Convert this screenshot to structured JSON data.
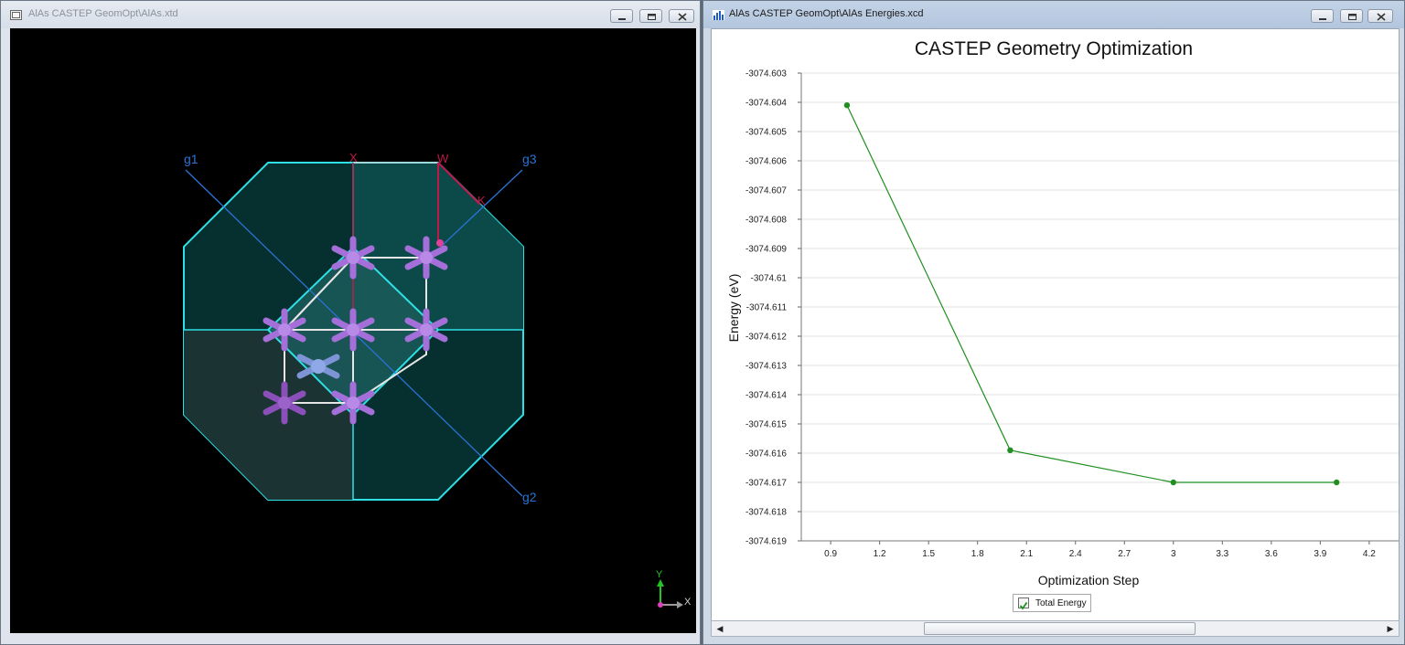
{
  "left_window": {
    "title": "AlAs CASTEP GeomOpt\\AlAs.xtd",
    "axis_labels": {
      "g1": "g1",
      "g2": "g2",
      "g3": "g3",
      "x_top": "X",
      "w": "W",
      "k": "K"
    },
    "triad": {
      "x": "X",
      "y": "Y"
    }
  },
  "right_window": {
    "title": "AlAs CASTEP GeomOpt\\AlAs Energies.xcd"
  },
  "chart_data": {
    "type": "line",
    "title": "CASTEP Geometry Optimization",
    "xlabel": "Optimization Step",
    "ylabel": "Energy (eV)",
    "xlim": [
      0.72,
      4.38
    ],
    "ylim": [
      -3074.619,
      -3074.603
    ],
    "x_ticks": [
      "0.9",
      "1.2",
      "1.5",
      "1.8",
      "2.1",
      "2.4",
      "2.7",
      "3",
      "3.3",
      "3.6",
      "3.9",
      "4.2"
    ],
    "x_tick_values": [
      0.9,
      1.2,
      1.5,
      1.8,
      2.1,
      2.4,
      2.7,
      3.0,
      3.3,
      3.6,
      3.9,
      4.2
    ],
    "y_ticks": [
      "-3074.603",
      "-3074.604",
      "-3074.605",
      "-3074.606",
      "-3074.607",
      "-3074.608",
      "-3074.609",
      "-3074.61",
      "-3074.611",
      "-3074.612",
      "-3074.613",
      "-3074.614",
      "-3074.615",
      "-3074.616",
      "-3074.617",
      "-3074.618",
      "-3074.619"
    ],
    "y_tick_values": [
      -3074.603,
      -3074.604,
      -3074.605,
      -3074.606,
      -3074.607,
      -3074.608,
      -3074.609,
      -3074.61,
      -3074.611,
      -3074.612,
      -3074.613,
      -3074.614,
      -3074.615,
      -3074.616,
      -3074.617,
      -3074.618,
      -3074.619
    ],
    "grid": "horizontal",
    "legend_position": "bottom-center",
    "series": [
      {
        "name": "Total Energy",
        "color": "#1f8f1f",
        "x": [
          1,
          2,
          3,
          4
        ],
        "y": [
          -3074.6041,
          -3074.6159,
          -3074.617,
          -3074.617
        ]
      }
    ]
  },
  "colors": {
    "series": "#1f8f1f",
    "cyan": "#2ee0e6",
    "atom": "#a56fd9",
    "g_axis": "#2a73d6",
    "red_axis": "#c0174a"
  }
}
